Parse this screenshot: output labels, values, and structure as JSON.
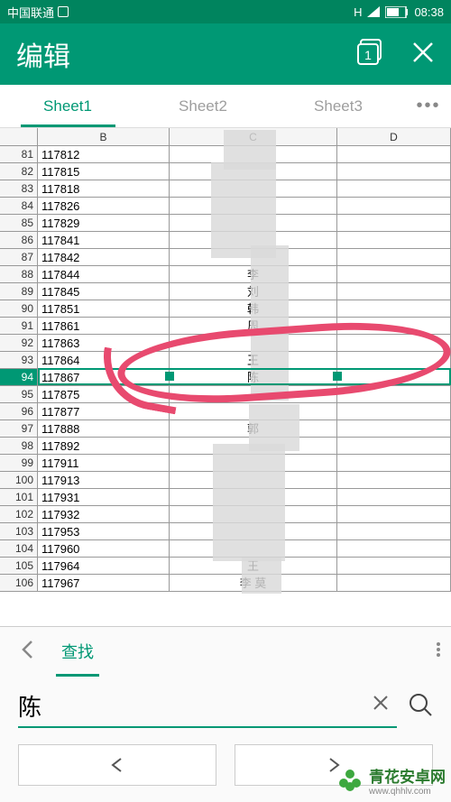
{
  "status": {
    "carrier": "中国联通",
    "time": "08:38",
    "network": "H"
  },
  "header": {
    "title": "编辑",
    "win_badge": "1"
  },
  "tabs": {
    "items": [
      "Sheet1",
      "Sheet2",
      "Sheet3"
    ],
    "active": 0
  },
  "columns": [
    "B",
    "C",
    "D"
  ],
  "selected_row": 94,
  "rows": [
    {
      "n": 81,
      "b": "117812",
      "c": ""
    },
    {
      "n": 82,
      "b": "117815",
      "c": ""
    },
    {
      "n": 83,
      "b": "117818",
      "c": ""
    },
    {
      "n": 84,
      "b": "117826",
      "c": ""
    },
    {
      "n": 85,
      "b": "117829",
      "c": ""
    },
    {
      "n": 86,
      "b": "117841",
      "c": ""
    },
    {
      "n": 87,
      "b": "117842",
      "c": ""
    },
    {
      "n": 88,
      "b": "117844",
      "c": "李"
    },
    {
      "n": 89,
      "b": "117845",
      "c": "刘"
    },
    {
      "n": 90,
      "b": "117851",
      "c": "韩"
    },
    {
      "n": 91,
      "b": "117861",
      "c": "周"
    },
    {
      "n": 92,
      "b": "117863",
      "c": ""
    },
    {
      "n": 93,
      "b": "117864",
      "c": "王"
    },
    {
      "n": 94,
      "b": "117867",
      "c": "陈"
    },
    {
      "n": 95,
      "b": "117875",
      "c": ""
    },
    {
      "n": 96,
      "b": "117877",
      "c": ""
    },
    {
      "n": 97,
      "b": "117888",
      "c": "郭"
    },
    {
      "n": 98,
      "b": "117892",
      "c": ""
    },
    {
      "n": 99,
      "b": "117911",
      "c": ""
    },
    {
      "n": 100,
      "b": "117913",
      "c": ""
    },
    {
      "n": 101,
      "b": "117931",
      "c": ""
    },
    {
      "n": 102,
      "b": "117932",
      "c": ""
    },
    {
      "n": 103,
      "b": "117953",
      "c": ""
    },
    {
      "n": 104,
      "b": "117960",
      "c": ""
    },
    {
      "n": 105,
      "b": "117964",
      "c": "王"
    },
    {
      "n": 106,
      "b": "117967",
      "c": "李   莫"
    }
  ],
  "search": {
    "tab_label": "查找",
    "value": "陈"
  },
  "watermark": {
    "brand": "青花安卓网",
    "url": "www.qhhlv.com"
  }
}
